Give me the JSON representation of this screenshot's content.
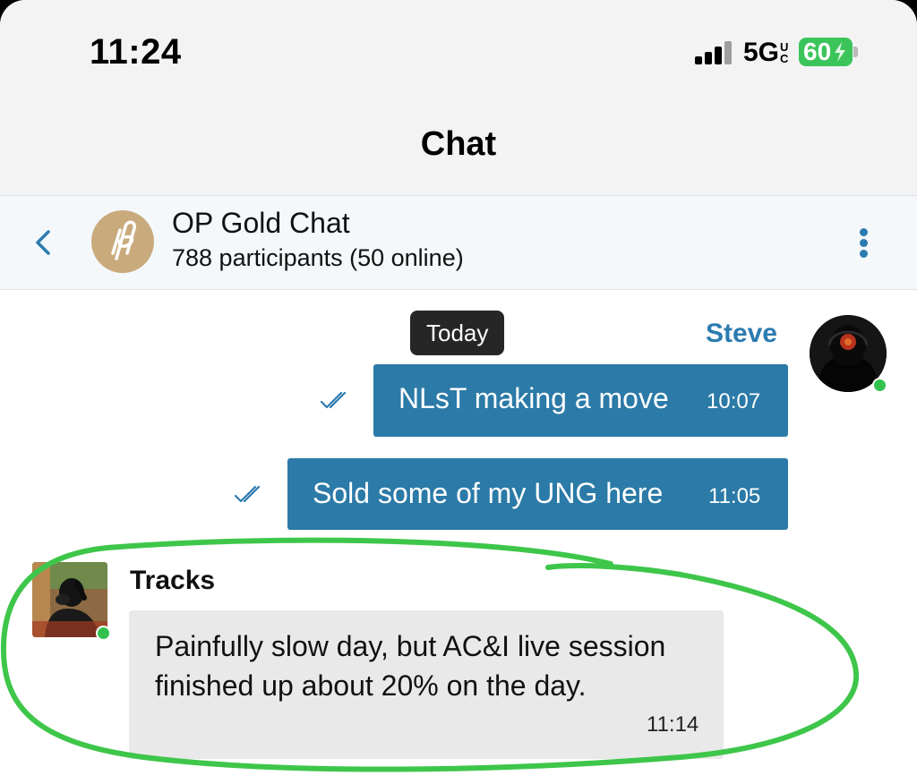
{
  "status_bar": {
    "time": "11:24",
    "network": "5G",
    "network_sub": "UC",
    "battery": "60"
  },
  "nav": {
    "title": "Chat"
  },
  "chat_header": {
    "group_name": "OP Gold Chat",
    "participants": "788 participants (50 online)"
  },
  "date_chip": "Today",
  "messages": [
    {
      "sender": "Steve",
      "text": "NLsT making a move",
      "time": "10:07"
    },
    {
      "text": "Sold some of my UNG here",
      "time": "11:05"
    },
    {
      "sender": "Tracks",
      "text": "Painfully slow day, but AC&I live session finished up about 20% on the day.",
      "time": "11:14"
    }
  ],
  "colors": {
    "accent": "#2c7bb0",
    "outgoing_bubble": "#2b7aa7",
    "incoming_bubble": "#e9e9e9",
    "online": "#33c24f",
    "battery": "#3bc45a",
    "highlight": "#3ec64a"
  },
  "icons": {
    "back": "chevron-left-icon",
    "menu": "more-vertical-icon",
    "read_receipt": "double-check-icon",
    "signal": "signal-bars-icon",
    "battery": "battery-charging-icon"
  }
}
